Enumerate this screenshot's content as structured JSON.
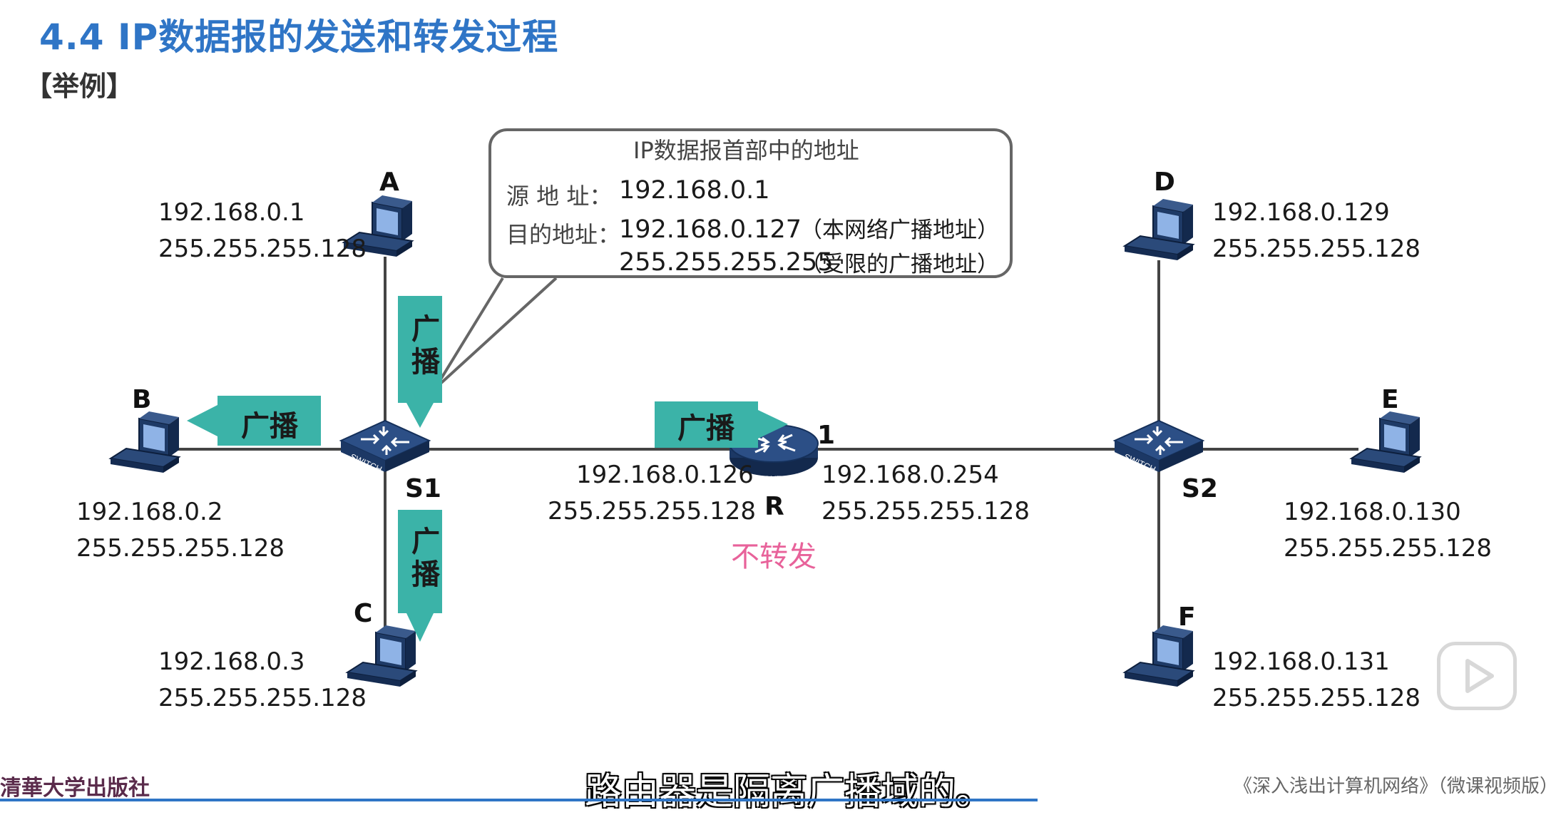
{
  "slide": {
    "title": "4.4  IP数据报的发送和转发过程",
    "example_tag": "【举例】"
  },
  "nodes": {
    "A": {
      "label": "A",
      "ip": "192.168.0.1",
      "mask": "255.255.255.128"
    },
    "B": {
      "label": "B",
      "ip": "192.168.0.2",
      "mask": "255.255.255.128"
    },
    "C": {
      "label": "C",
      "ip": "192.168.0.3",
      "mask": "255.255.255.128"
    },
    "D": {
      "label": "D",
      "ip": "192.168.0.129",
      "mask": "255.255.255.128"
    },
    "E": {
      "label": "E",
      "ip": "192.168.0.130",
      "mask": "255.255.255.128"
    },
    "F": {
      "label": "F",
      "ip": "192.168.0.131",
      "mask": "255.255.255.128"
    }
  },
  "switches": {
    "S1": {
      "label": "S1",
      "badge": "SWITCH"
    },
    "S2": {
      "label": "S2",
      "badge": "SWITCH"
    }
  },
  "router": {
    "label": "R",
    "badge": "ROUTER",
    "port_label": "1",
    "left_ip": "192.168.0.126",
    "left_mask": "255.255.255.128",
    "right_ip": "192.168.0.254",
    "right_mask": "255.255.255.128",
    "status": "不转发"
  },
  "callout": {
    "title": "IP数据报首部中的地址",
    "src_label": "源 地 址：",
    "src_value": "192.168.0.1",
    "dst_label": "目的地址：",
    "dst_value_1": "192.168.0.127",
    "dst_note_1": "（本网络广播地址）",
    "dst_value_2": "255.255.255.255",
    "dst_note_2": "（受限的广播地址）"
  },
  "broadcast_label": "广播",
  "colors": {
    "title": "#2f75c6",
    "arrow": "#3bb3a8",
    "no_forward": "#e8629a",
    "link": "#444444"
  },
  "footer": {
    "subtitle": "路由器是隔离广播域的。",
    "publisher": "清華大学出版社",
    "book_title": "《深入浅出计算机网络》（微课视频版）"
  }
}
